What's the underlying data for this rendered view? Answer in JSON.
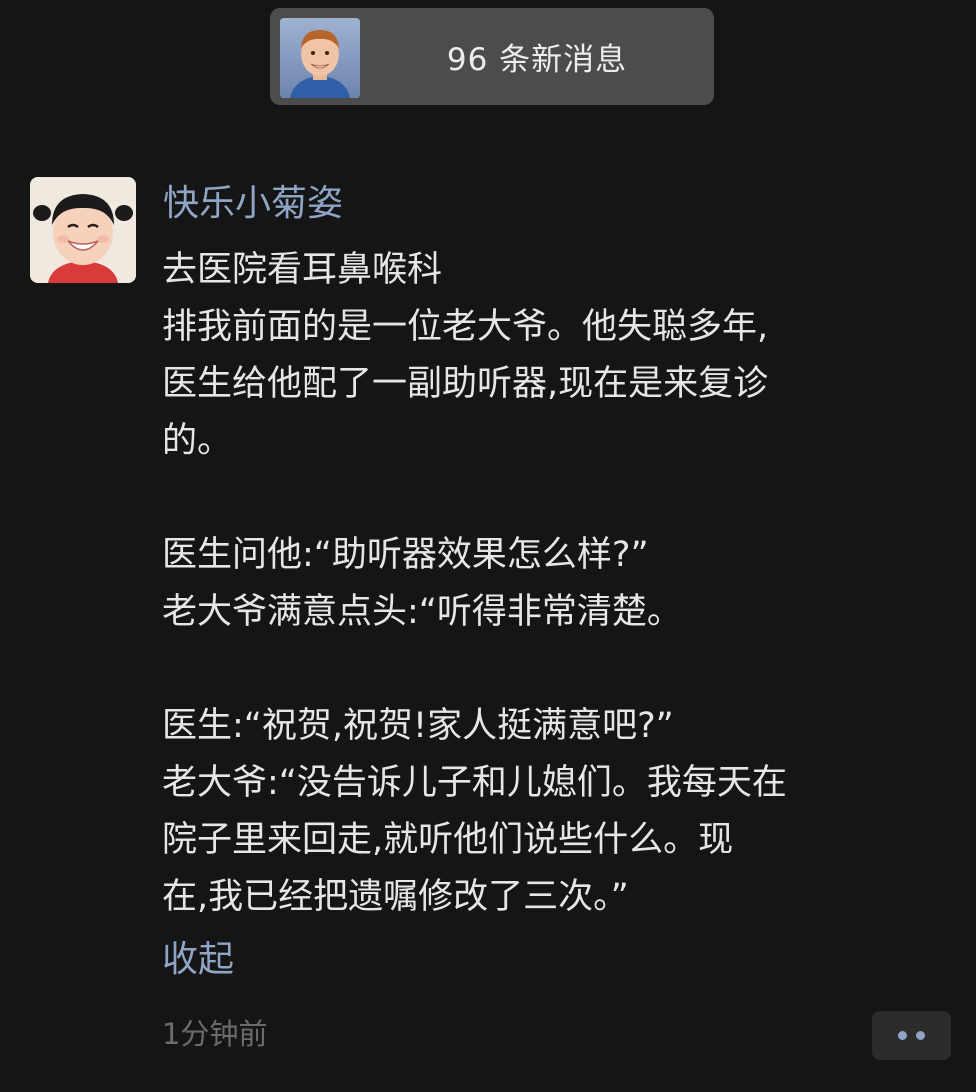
{
  "new_messages": {
    "label": "96 条新消息"
  },
  "post": {
    "username": "快乐小菊姿",
    "lines": [
      "去医院看耳鼻喉科",
      "排我前面的是一位老大爷。他失聪多年,",
      "医生给他配了一副助听器,现在是来复诊",
      "的。",
      "",
      "医生问他:“助听器效果怎么样?”",
      "老大爷满意点头:“听得非常清楚。",
      "",
      "医生:“祝贺,祝贺!家人挺满意吧?”",
      "老大爷:“没告诉儿子和儿媳们。我每天在",
      "院子里来回走,就听他们说些什么。现",
      "在,我已经把遗嘱修改了三次。”"
    ],
    "collapse_label": "收起",
    "timestamp": "1分钟前"
  },
  "colors": {
    "background": "#151515",
    "link": "#8ea5c5",
    "text": "#e6e6e6",
    "muted": "#6b6b6b"
  },
  "icons": {
    "more": "more-dots-icon"
  }
}
